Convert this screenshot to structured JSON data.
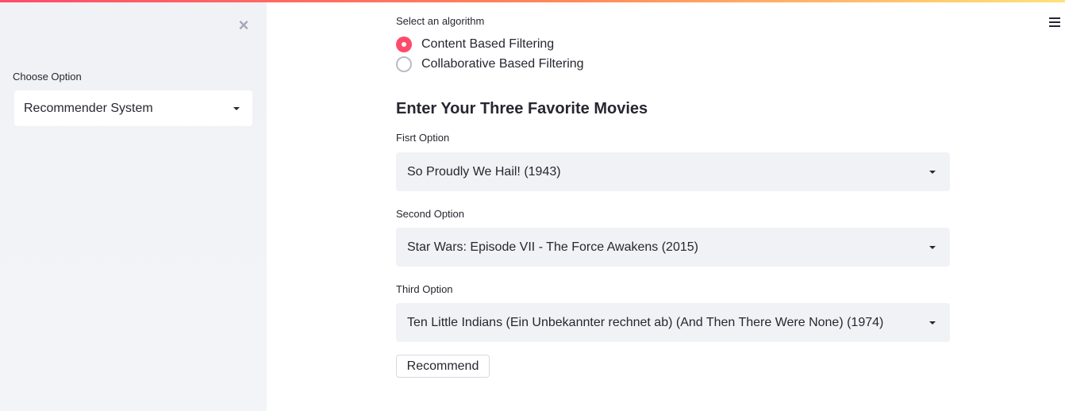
{
  "sidebar": {
    "close_symbol": "×",
    "choose_label": "Choose Option",
    "selected_page": "Recommender System"
  },
  "menu_icon": "hamburger-menu-icon",
  "algorithm": {
    "label": "Select an algorithm",
    "options": [
      {
        "label": "Content Based Filtering",
        "selected": true
      },
      {
        "label": "Collaborative Based Filtering",
        "selected": false
      }
    ]
  },
  "heading": "Enter Your Three Favorite Movies",
  "movies": [
    {
      "label": "Fisrt Option",
      "value": "So Proudly We Hail! (1943)"
    },
    {
      "label": "Second Option",
      "value": "Star Wars: Episode VII - The Force Awakens (2015)"
    },
    {
      "label": "Third Option",
      "value": "Ten Little Indians (Ein Unbekannter rechnet ab) (And Then There Were None) (1974)"
    }
  ],
  "recommend_button": "Recommend",
  "colors": {
    "accent": "#ff4b6b",
    "sidebar_bg": "#f0f2f6",
    "select_bg": "#f0f2f6",
    "text": "#262730"
  }
}
